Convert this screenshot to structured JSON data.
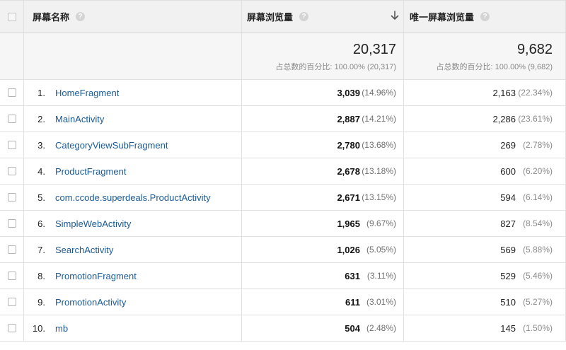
{
  "header": {
    "screen_name": "屏幕名称",
    "pageviews": "屏幕浏览量",
    "unique_pageviews": "唯一屏幕浏览量",
    "help_glyph": "?"
  },
  "totals": {
    "pageviews": "20,317",
    "pageviews_sub": "占总数的百分比: 100.00% (20,317)",
    "unique_pageviews": "9,682",
    "unique_pageviews_sub": "占总数的百分比: 100.00% (9,682)"
  },
  "rows": [
    {
      "idx": "1.",
      "name": "HomeFragment",
      "pv": "3,039",
      "pv_pct": "(14.96%)",
      "upv": "2,163",
      "upv_pct": "(22.34%)"
    },
    {
      "idx": "2.",
      "name": "MainActivity",
      "pv": "2,887",
      "pv_pct": "(14.21%)",
      "upv": "2,286",
      "upv_pct": "(23.61%)"
    },
    {
      "idx": "3.",
      "name": "CategoryViewSubFragment",
      "pv": "2,780",
      "pv_pct": "(13.68%)",
      "upv": "269",
      "upv_pct": "(2.78%)"
    },
    {
      "idx": "4.",
      "name": "ProductFragment",
      "pv": "2,678",
      "pv_pct": "(13.18%)",
      "upv": "600",
      "upv_pct": "(6.20%)"
    },
    {
      "idx": "5.",
      "name": "com.ccode.superdeals.ProductActivity",
      "pv": "2,671",
      "pv_pct": "(13.15%)",
      "upv": "594",
      "upv_pct": "(6.14%)"
    },
    {
      "idx": "6.",
      "name": "SimpleWebActivity",
      "pv": "1,965",
      "pv_pct": "(9.67%)",
      "upv": "827",
      "upv_pct": "(8.54%)"
    },
    {
      "idx": "7.",
      "name": "SearchActivity",
      "pv": "1,026",
      "pv_pct": "(5.05%)",
      "upv": "569",
      "upv_pct": "(5.88%)"
    },
    {
      "idx": "8.",
      "name": "PromotionFragment",
      "pv": "631",
      "pv_pct": "(3.11%)",
      "upv": "529",
      "upv_pct": "(5.46%)"
    },
    {
      "idx": "9.",
      "name": "PromotionActivity",
      "pv": "611",
      "pv_pct": "(3.01%)",
      "upv": "510",
      "upv_pct": "(5.27%)"
    },
    {
      "idx": "10.",
      "name": "mb",
      "pv": "504",
      "pv_pct": "(2.48%)",
      "upv": "145",
      "upv_pct": "(1.50%)"
    }
  ],
  "icons": {
    "sort": "sort-descending-arrow-icon",
    "help": "help-circle-icon"
  }
}
